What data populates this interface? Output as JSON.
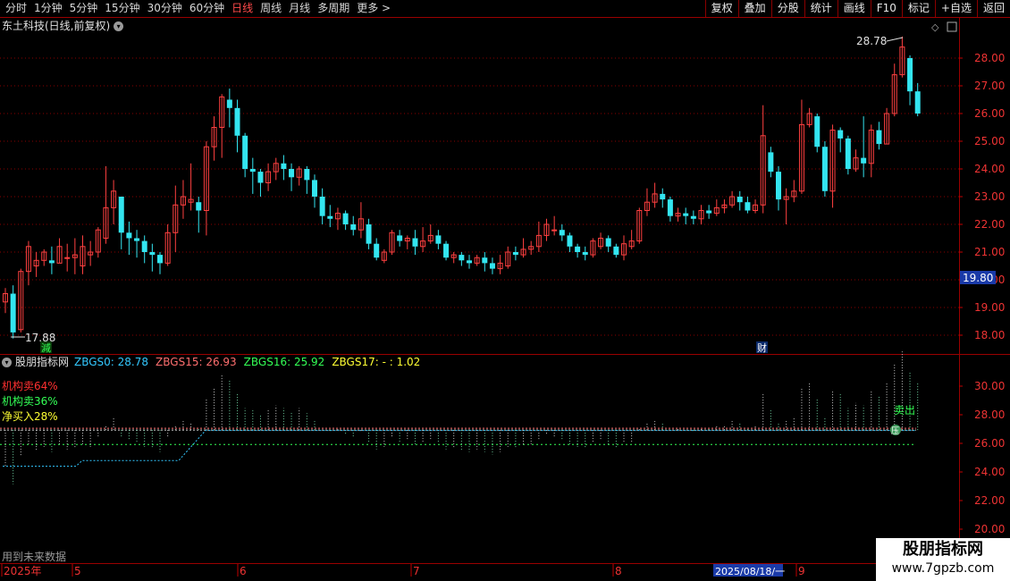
{
  "toolbar": {
    "periods": [
      "分时",
      "1分钟",
      "5分钟",
      "15分钟",
      "30分钟",
      "60分钟",
      "日线",
      "周线",
      "月线",
      "多周期",
      "更多 >"
    ],
    "active_period": "日线",
    "buttons": [
      "复权",
      "叠加",
      "分股",
      "统计",
      "画线",
      "F10",
      "标记",
      "+自选",
      "返回"
    ]
  },
  "title": {
    "stock": "东土科技(日线,前复权)"
  },
  "price_axis": [
    "28.00",
    "27.00",
    "26.00",
    "25.00",
    "24.00",
    "23.00",
    "22.00",
    "21.00",
    "20.00",
    "19.00",
    "18.00"
  ],
  "current_price_tag": "19.80",
  "annotations": {
    "high": "28.78",
    "low": "17.88",
    "event_jian": "減",
    "event_cai": "财"
  },
  "indicator": {
    "name": "股朋指标网",
    "values": [
      {
        "label": "ZBGS0: 28.78",
        "color": "#33c8ff"
      },
      {
        "label": "ZBGS15: 26.93",
        "color": "#ff6f6f"
      },
      {
        "label": "ZBGS16: 25.92",
        "color": "#33ff55"
      },
      {
        "label": "ZBGS17: - : 1.02",
        "color": "#ffff33"
      }
    ],
    "signals": [
      {
        "label": "机构卖64%",
        "color": "#ff3030"
      },
      {
        "label": "机构卖36%",
        "color": "#33ff55"
      },
      {
        "label": "净买入28%",
        "color": "#ffff33"
      }
    ],
    "axis": [
      "30.00",
      "28.00",
      "26.00",
      "24.00",
      "22.00",
      "20.00"
    ],
    "sell_marker": "卖出",
    "dot_marker": "压"
  },
  "footnote": "用到未来数据",
  "date_axis": {
    "labels": [
      "2025年",
      "5",
      "6",
      "7",
      "8",
      "9"
    ],
    "cursor_date": "2025/08/18/一"
  },
  "watermark": {
    "title": "股朋指标网",
    "url": "www.7gpzb.com"
  },
  "colors": {
    "up": "#ff4040",
    "down": "#33e5f0",
    "grid": "#8a0000",
    "background": "#000000"
  },
  "chart_data": {
    "type": "candlestick",
    "date_range": "2025-04 to 2025-09",
    "price_range": [
      17.5,
      29.2
    ],
    "candles": [
      [
        19.2,
        19.5,
        19.7,
        18.8
      ],
      [
        19.5,
        18.1,
        19.8,
        17.88
      ],
      [
        18.2,
        20.3,
        20.4,
        18.1
      ],
      [
        20.3,
        21.2,
        21.4,
        19.8
      ],
      [
        20.5,
        20.7,
        21.0,
        20.1
      ],
      [
        20.7,
        21.0,
        21.1,
        20.5
      ],
      [
        20.7,
        20.6,
        21.2,
        20.2
      ],
      [
        20.6,
        21.2,
        21.5,
        20.6
      ],
      [
        20.8,
        20.8,
        21.3,
        20.3
      ],
      [
        20.8,
        20.9,
        21.5,
        20.2
      ],
      [
        20.5,
        21.2,
        21.6,
        20.2
      ],
      [
        20.9,
        21.0,
        21.4,
        20.5
      ],
      [
        21.0,
        21.8,
        21.9,
        20.8
      ],
      [
        21.5,
        22.6,
        24.1,
        21.3
      ],
      [
        22.6,
        23.2,
        23.6,
        22.0
      ],
      [
        23.0,
        21.7,
        22.9,
        21.1
      ],
      [
        21.7,
        21.5,
        22.1,
        20.9
      ],
      [
        21.5,
        21.4,
        21.8,
        20.8
      ],
      [
        21.4,
        21.0,
        21.6,
        20.6
      ],
      [
        21.0,
        20.9,
        21.3,
        20.3
      ],
      [
        20.9,
        20.6,
        21.0,
        20.2
      ],
      [
        20.6,
        21.7,
        22.0,
        20.5
      ],
      [
        21.7,
        22.7,
        23.4,
        21.0
      ],
      [
        22.7,
        23.0,
        23.6,
        22.2
      ],
      [
        22.8,
        22.9,
        24.2,
        22.5
      ],
      [
        22.8,
        22.5,
        23.0,
        21.7
      ],
      [
        22.5,
        24.8,
        25.0,
        21.6
      ],
      [
        24.8,
        25.5,
        25.9,
        24.3
      ],
      [
        25.5,
        26.6,
        26.7,
        24.4
      ],
      [
        26.5,
        26.2,
        26.9,
        25.5
      ],
      [
        26.2,
        25.2,
        26.5,
        24.6
      ],
      [
        25.2,
        24.0,
        25.3,
        23.7
      ],
      [
        24.0,
        23.9,
        24.4,
        23.1
      ],
      [
        23.9,
        23.5,
        24.0,
        23.0
      ],
      [
        23.5,
        23.9,
        24.2,
        23.2
      ],
      [
        23.9,
        24.2,
        24.4,
        23.6
      ],
      [
        24.2,
        24.0,
        24.5,
        23.6
      ],
      [
        24.0,
        23.7,
        24.2,
        23.2
      ],
      [
        23.7,
        24.0,
        24.1,
        23.4
      ],
      [
        24.0,
        23.6,
        24.1,
        23.1
      ],
      [
        23.6,
        23.0,
        23.8,
        22.6
      ],
      [
        23.0,
        22.3,
        23.3,
        22.0
      ],
      [
        22.3,
        22.2,
        22.7,
        21.9
      ],
      [
        22.2,
        22.4,
        22.6,
        21.8
      ],
      [
        22.4,
        22.0,
        22.5,
        21.8
      ],
      [
        22.0,
        21.8,
        22.3,
        21.6
      ],
      [
        21.8,
        22.2,
        22.8,
        21.5
      ],
      [
        22.0,
        21.3,
        22.2,
        21.1
      ],
      [
        21.3,
        20.8,
        21.5,
        20.7
      ],
      [
        20.7,
        21.0,
        21.1,
        20.6
      ],
      [
        21.0,
        21.7,
        21.8,
        20.9
      ],
      [
        21.6,
        21.4,
        21.8,
        21.2
      ],
      [
        21.4,
        21.5,
        21.6,
        21.1
      ],
      [
        21.5,
        21.2,
        21.8,
        20.9
      ],
      [
        21.2,
        21.4,
        21.9,
        21.0
      ],
      [
        21.4,
        21.6,
        22.0,
        21.3
      ],
      [
        21.6,
        21.3,
        21.8,
        21.1
      ],
      [
        21.3,
        20.8,
        21.4,
        20.7
      ],
      [
        20.8,
        20.9,
        21.0,
        20.6
      ],
      [
        20.9,
        20.7,
        21.0,
        20.5
      ],
      [
        20.7,
        20.6,
        20.9,
        20.4
      ],
      [
        20.6,
        20.8,
        20.9,
        20.5
      ],
      [
        20.8,
        20.6,
        21.0,
        20.3
      ],
      [
        20.6,
        20.4,
        20.8,
        20.2
      ],
      [
        20.4,
        20.6,
        20.9,
        20.2
      ],
      [
        20.5,
        21.0,
        21.2,
        20.4
      ],
      [
        21.0,
        20.9,
        21.2,
        20.7
      ],
      [
        20.9,
        21.1,
        21.5,
        20.8
      ],
      [
        21.1,
        21.2,
        21.4,
        20.9
      ],
      [
        21.2,
        21.6,
        22.1,
        21.0
      ],
      [
        21.6,
        22.0,
        22.2,
        21.4
      ],
      [
        21.8,
        21.8,
        22.3,
        21.6
      ],
      [
        21.8,
        21.6,
        22.0,
        21.4
      ],
      [
        21.6,
        21.2,
        21.7,
        21.0
      ],
      [
        21.2,
        21.0,
        21.3,
        20.8
      ],
      [
        21.0,
        20.9,
        21.2,
        20.7
      ],
      [
        20.9,
        21.4,
        21.5,
        20.8
      ],
      [
        21.2,
        21.5,
        21.7,
        21.1
      ],
      [
        21.5,
        21.2,
        21.6,
        21.0
      ],
      [
        21.2,
        20.9,
        21.3,
        20.8
      ],
      [
        20.9,
        21.3,
        21.6,
        20.7
      ],
      [
        21.2,
        21.4,
        21.8,
        21.1
      ],
      [
        21.4,
        22.5,
        22.6,
        21.3
      ],
      [
        22.5,
        22.8,
        23.3,
        22.3
      ],
      [
        22.8,
        23.1,
        23.5,
        22.6
      ],
      [
        23.1,
        22.9,
        23.3,
        22.6
      ],
      [
        22.9,
        22.3,
        23.0,
        22.1
      ],
      [
        22.3,
        22.4,
        22.6,
        22.1
      ],
      [
        22.4,
        22.3,
        22.6,
        22.0
      ],
      [
        22.3,
        22.2,
        22.5,
        22.0
      ],
      [
        22.2,
        22.5,
        22.7,
        22.0
      ],
      [
        22.5,
        22.4,
        22.7,
        22.2
      ],
      [
        22.4,
        22.6,
        22.9,
        22.3
      ],
      [
        22.6,
        22.7,
        22.9,
        22.4
      ],
      [
        22.7,
        23.0,
        23.2,
        22.6
      ],
      [
        23.0,
        22.8,
        23.2,
        22.5
      ],
      [
        22.8,
        22.5,
        23.0,
        22.4
      ],
      [
        22.5,
        22.7,
        22.9,
        22.4
      ],
      [
        22.7,
        25.2,
        26.3,
        22.4
      ],
      [
        24.6,
        23.9,
        24.8,
        23.7
      ],
      [
        23.9,
        22.9,
        24.1,
        22.5
      ],
      [
        22.9,
        23.0,
        23.3,
        22.0
      ],
      [
        23.0,
        23.2,
        23.6,
        22.8
      ],
      [
        23.2,
        25.6,
        26.5,
        23.1
      ],
      [
        25.6,
        26.0,
        26.2,
        25.5
      ],
      [
        25.9,
        24.8,
        26.0,
        24.6
      ],
      [
        24.8,
        23.2,
        25.0,
        23.0
      ],
      [
        23.2,
        25.4,
        25.6,
        22.6
      ],
      [
        25.4,
        25.1,
        25.5,
        24.6
      ],
      [
        25.1,
        24.0,
        25.2,
        23.8
      ],
      [
        24.0,
        24.4,
        24.7,
        23.9
      ],
      [
        24.4,
        24.2,
        25.9,
        23.7
      ],
      [
        24.2,
        25.4,
        25.6,
        23.7
      ],
      [
        25.4,
        24.9,
        25.7,
        24.7
      ],
      [
        24.9,
        26.0,
        26.2,
        24.9
      ],
      [
        26.0,
        27.4,
        27.8,
        25.9
      ],
      [
        27.4,
        28.4,
        28.78,
        27.3
      ],
      [
        28.0,
        26.8,
        28.1,
        26.3
      ],
      [
        26.8,
        26.0,
        27.1,
        25.9
      ]
    ],
    "indicator_lines": {
      "ZBGS0": 28.78,
      "ZBGS15": 26.93,
      "ZBGS16": 25.92
    }
  }
}
